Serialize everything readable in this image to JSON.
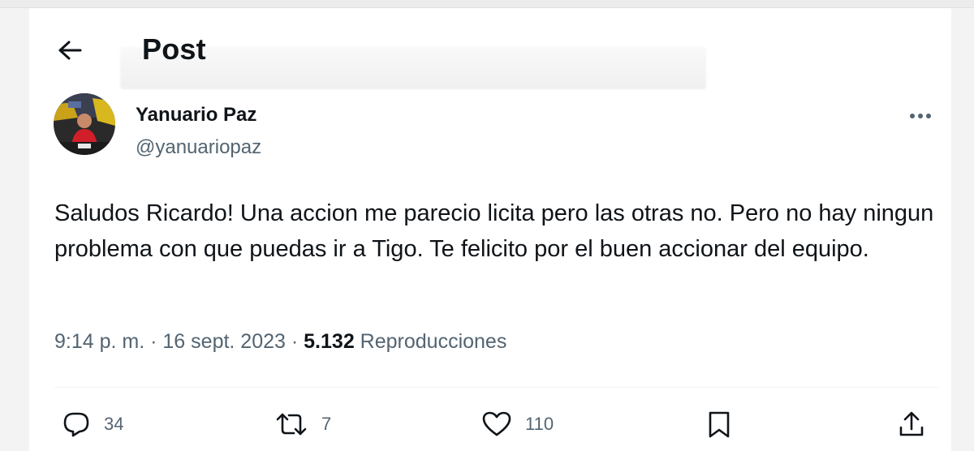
{
  "header": {
    "back_icon": "arrow-left-icon",
    "title": "Post"
  },
  "post": {
    "author": {
      "display_name": "Yanuario Paz",
      "handle": "@yanuariopaz"
    },
    "more_icon": "ellipsis-icon",
    "text": "Saludos Ricardo! Una accion me parecio licita pero las otras no. Pero no hay ningun problema con que puedas ir a Tigo. Te felicito por el buen accionar del equipo.",
    "meta": {
      "time": "9:14 p. m.",
      "separator": "·",
      "date": "16 sept. 2023",
      "views": "5.132",
      "views_label": "Reproducciones"
    },
    "actions": {
      "reply": {
        "icon": "reply-icon",
        "count": "34"
      },
      "repost": {
        "icon": "repost-icon",
        "count": "7"
      },
      "like": {
        "icon": "heart-icon",
        "count": "110"
      },
      "bookmark": {
        "icon": "bookmark-icon"
      },
      "share": {
        "icon": "share-icon"
      }
    }
  },
  "colors": {
    "text_primary": "#0f1419",
    "text_secondary": "#536471",
    "divider": "#eff3f4"
  }
}
